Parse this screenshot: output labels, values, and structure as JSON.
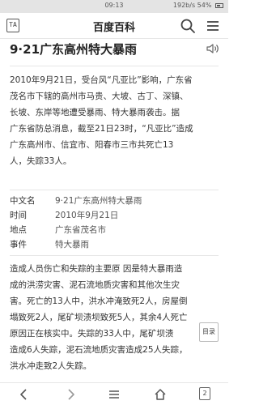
{
  "statusbar": {
    "time": "09:13",
    "speed": "192b/s",
    "battery": "54%"
  },
  "header": {
    "logo_text": "TA",
    "title": "百度百科"
  },
  "article": {
    "title": "9·21广东高州特大暴雨",
    "intro_lines": [
      "2010年9月21日，受台风“凡亚比”影响，广东省",
      "茂名市下辖的高州市马贵、大坡、古丁、深镇、",
      "长坡、东岸等地遭受暴雨、特大暴雨袭击。据",
      "广东省防总消息，截至21日23时，“凡亚比”造成",
      "广东高州市、信宜市、阳春市三市共死亡13",
      "人，失踪33人。"
    ],
    "infobox": [
      {
        "key": "中文名",
        "value": "9·21广东高州特大暴雨"
      },
      {
        "key": "时间",
        "value": "2010年9月21日"
      },
      {
        "key": "地点",
        "value": "广东省茂名市"
      },
      {
        "key": "事件",
        "value": "特大暴雨"
      }
    ],
    "body_lines": [
      "造成人员伤亡和失踪的主要原 因是特大暴雨造",
      "成的洪涝灾害、泥石流地质灾害和其他次生灾",
      "害。死亡的13人中，洪水冲淹致死2人，房屋倒",
      "塌致死2人，尾矿坝溃坝致死5人，其余4人死亡",
      "原因正在核实中。失踪的33人中，尾矿坝溃",
      "造成6人失踪，泥石流地质灾害造成25人失踪，",
      "洪水冲走致2人失踪。"
    ]
  },
  "catalog_label": "目录",
  "bottombar": {
    "tab_count": "2"
  }
}
